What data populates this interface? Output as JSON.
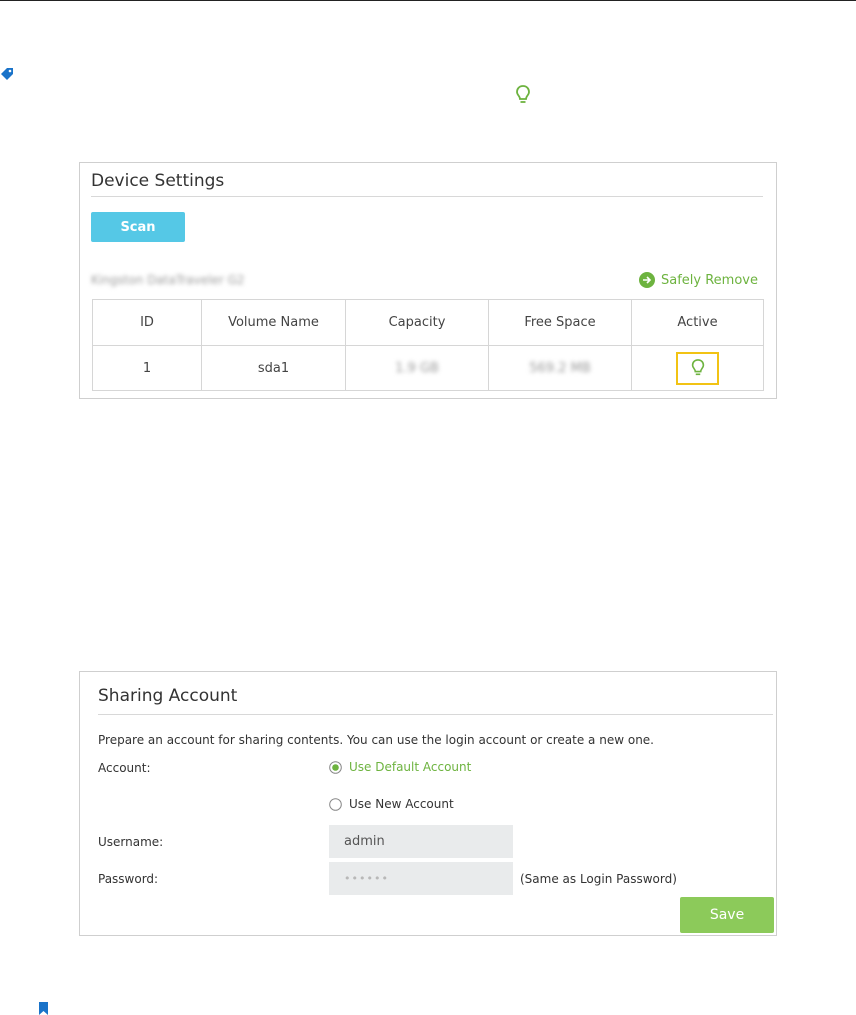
{
  "device_settings": {
    "title": "Device Settings",
    "scan_label": "Scan",
    "device_name": "Kingston DataTraveler G2",
    "safely_remove_label": "Safely Remove",
    "table": {
      "headers": [
        "ID",
        "Volume Name",
        "Capacity",
        "Free Space",
        "Active"
      ],
      "rows": [
        {
          "id": "1",
          "volume_name": "sda1",
          "capacity": "1.9 GB",
          "free_space": "569.2 MB",
          "active": "bulb-icon"
        }
      ]
    }
  },
  "sharing_account": {
    "title": "Sharing Account",
    "description": "Prepare an account for sharing contents. You can use the login account or create a new one.",
    "account_label": "Account:",
    "option_default": "Use Default Account",
    "option_new": "Use New Account",
    "selected_option": "Use Default Account",
    "username_label": "Username:",
    "username_value": "admin",
    "password_label": "Password:",
    "password_value": "••••••",
    "password_hint": "(Same as Login Password)",
    "save_label": "Save"
  },
  "colors": {
    "accent_green": "#6db33f",
    "scan_blue": "#55c8e6",
    "save_green": "#8cca5a",
    "highlight_yellow": "#f2c314",
    "icon_blue": "#1a73c9"
  }
}
